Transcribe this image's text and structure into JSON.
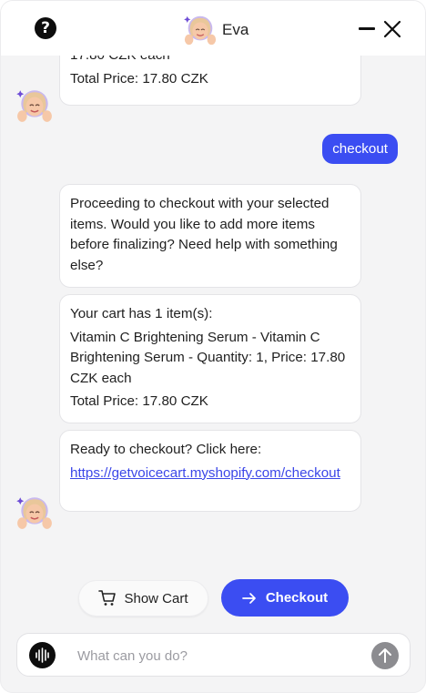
{
  "header": {
    "help_icon": "question-mark-icon",
    "avatar_icon": "assistant-avatar",
    "name": "Eva",
    "minimize_icon": "minimize-icon",
    "close_icon": "close-icon"
  },
  "messages": {
    "bot_partial": {
      "line1": "17.80 CZK each",
      "line2": "Total Price: 17.80 CZK"
    },
    "user_checkout": "checkout",
    "bot_proceeding": "Proceeding to checkout with your selected items. Would you like to add more items before finalizing? Need help with something else?",
    "bot_cart": {
      "line1": "Your cart has 1 item(s):",
      "line2": "Vitamin C Brightening Serum - Vitamin C Brightening Serum - Quantity: 1, Price: 17.80 CZK each",
      "line3": "Total Price: 17.80 CZK"
    },
    "bot_link": {
      "text": "Ready to checkout? Click here:",
      "url": "https://getvoicecart.myshopify.com/checkout"
    }
  },
  "actions": {
    "show_cart_label": "Show Cart",
    "checkout_label": "Checkout"
  },
  "composer": {
    "placeholder": "What can you do?",
    "value": ""
  },
  "colors": {
    "accent": "#3b4df2",
    "background": "#f4f4f5",
    "bubble": "#ffffff",
    "link": "#3b47e8"
  }
}
